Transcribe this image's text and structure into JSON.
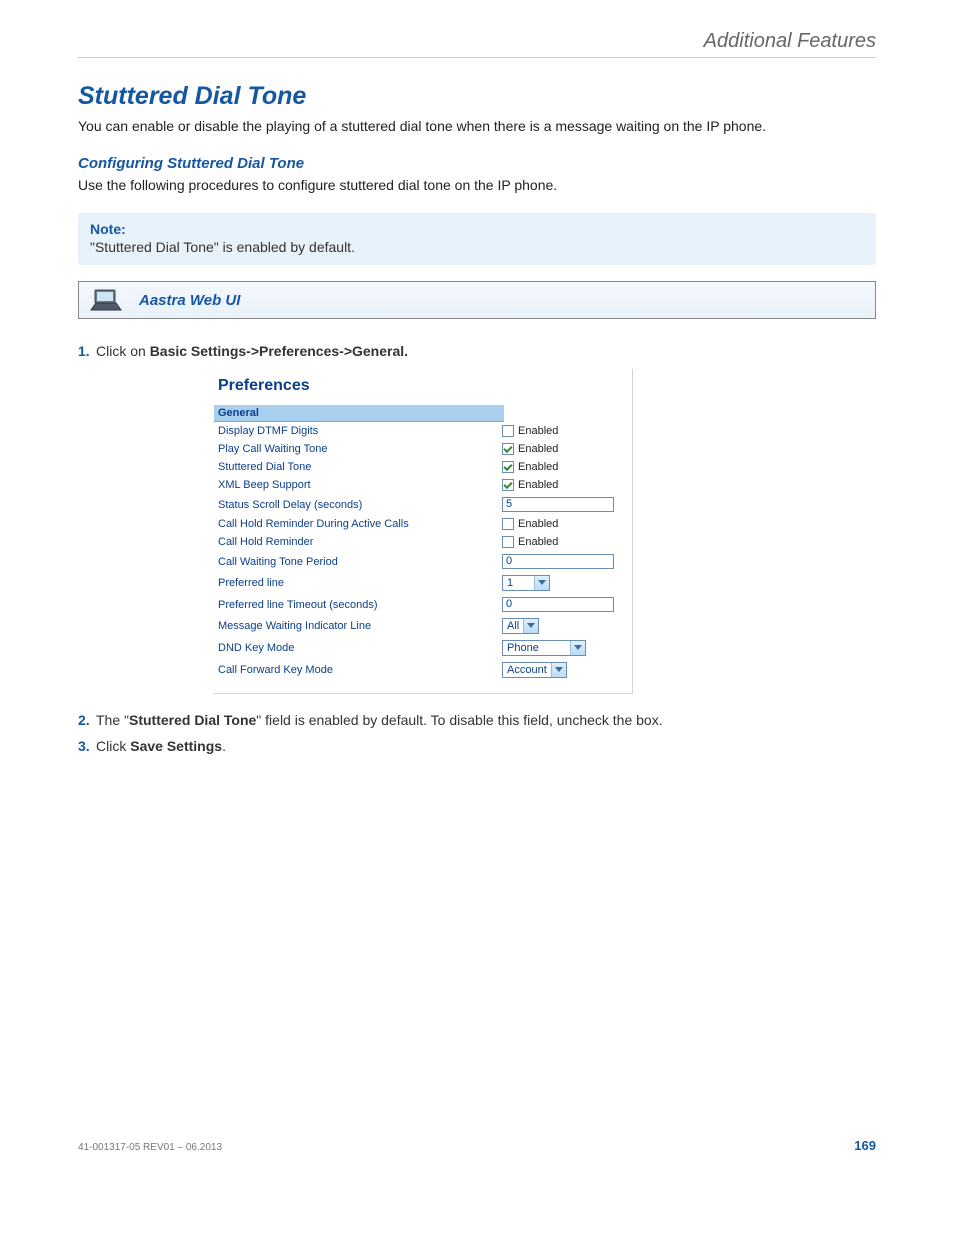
{
  "header": {
    "section": "Additional Features"
  },
  "title": "Stuttered Dial Tone",
  "intro": "You can enable or disable the playing of a stuttered dial tone when there is a message waiting on the IP phone.",
  "subtitle": "Configuring Stuttered Dial Tone",
  "sub_intro": "Use the following procedures to configure stuttered dial tone on the IP phone.",
  "note": {
    "label": "Note:",
    "text": "\"Stuttered Dial Tone\" is enabled by default."
  },
  "ui_bar": {
    "label": "Aastra Web UI"
  },
  "steps": {
    "s1": {
      "num": "1.",
      "pre": "Click on ",
      "bold": "Basic Settings->Preferences->General."
    },
    "s2": {
      "num": "2.",
      "pre": "The \"",
      "bold": "Stuttered Dial Tone",
      "post": "\" field is enabled by default. To disable this field, uncheck the box."
    },
    "s3": {
      "num": "3.",
      "pre": "Click ",
      "bold": "Save Settings",
      "post": "."
    }
  },
  "prefs": {
    "title": "Preferences",
    "section": "General",
    "enabled_label": "Enabled",
    "rows": {
      "dtmf": {
        "label": "Display DTMF Digits"
      },
      "cwt": {
        "label": "Play Call Waiting Tone"
      },
      "sdt": {
        "label": "Stuttered Dial Tone"
      },
      "xml": {
        "label": "XML Beep Support"
      },
      "ssd": {
        "label": "Status Scroll Delay (seconds)",
        "value": "5"
      },
      "chrdac": {
        "label": "Call Hold Reminder During Active Calls"
      },
      "chr": {
        "label": "Call Hold Reminder"
      },
      "cwtp": {
        "label": "Call Waiting Tone Period",
        "value": "0"
      },
      "pline": {
        "label": "Preferred line",
        "value": "1"
      },
      "plto": {
        "label": "Preferred line Timeout (seconds)",
        "value": "0"
      },
      "mwil": {
        "label": "Message Waiting Indicator Line",
        "value": "All"
      },
      "dnd": {
        "label": "DND Key Mode",
        "value": "Phone"
      },
      "cfkm": {
        "label": "Call Forward Key Mode",
        "value": "Account"
      }
    }
  },
  "footer": {
    "docid": "41-001317-05 REV01 – 06.2013",
    "page": "169"
  }
}
